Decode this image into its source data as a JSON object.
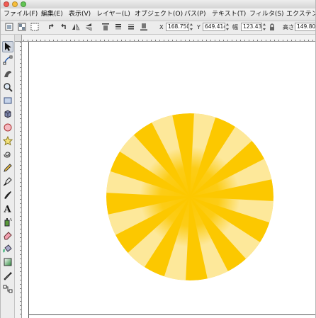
{
  "menu": [
    {
      "id": "file",
      "label": "ファイル(F)"
    },
    {
      "id": "edit",
      "label": "編集(E)"
    },
    {
      "id": "view",
      "label": "表示(V)"
    },
    {
      "id": "layer",
      "label": "レイヤー(L)"
    },
    {
      "id": "object",
      "label": "オブジェクト(O)"
    },
    {
      "id": "path",
      "label": "パス(P)"
    },
    {
      "id": "text",
      "label": "テキスト(T)"
    },
    {
      "id": "filter",
      "label": "フィルタ(S)"
    },
    {
      "id": "extensions",
      "label": "エクステンシ"
    }
  ],
  "controls": {
    "x_label": "X",
    "x_value": "168.750",
    "y_label": "Y",
    "y_value": "649.414",
    "w_label": "幅",
    "w_value": "123.438",
    "h_label": "高さ",
    "h_value": "149.805"
  },
  "tools": [
    "select-tool",
    "node-tool",
    "tweak-tool",
    "zoom-tool",
    "rectangle-tool",
    "box3d-tool",
    "ellipse-tool",
    "star-tool",
    "spiral-tool",
    "pencil-tool",
    "pen-tool",
    "calligraphy-tool",
    "text-tool",
    "spray-tool",
    "eraser-tool",
    "bucket-fill-tool",
    "gradient-tool",
    "dropper-tool",
    "connector-tool"
  ],
  "colors": {
    "sun_base": "#fcc800",
    "sun_ray_light": "#fde89a",
    "sun_core": "#fcc800"
  }
}
